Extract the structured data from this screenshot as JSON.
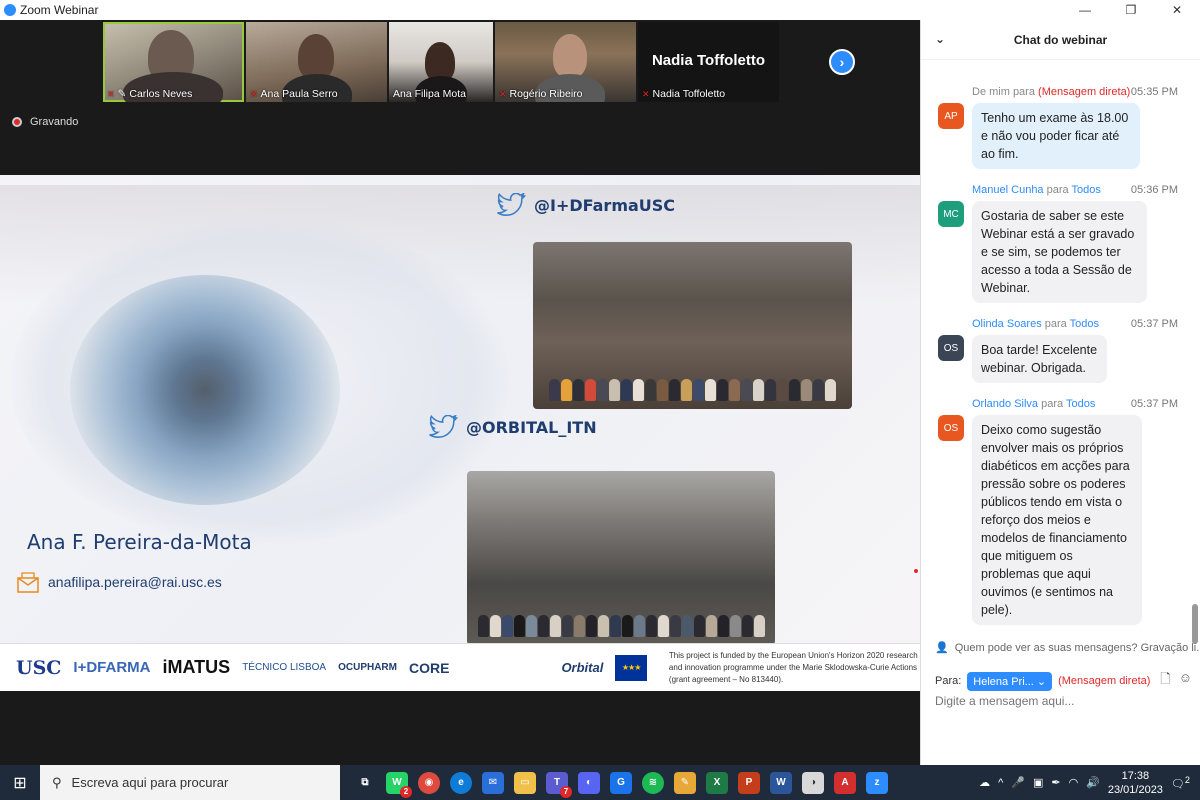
{
  "window": {
    "title": "Zoom Webinar"
  },
  "gallery": {
    "participants": [
      {
        "name": "Carlos Neves"
      },
      {
        "name": "Ana Paula Serro"
      },
      {
        "name": "Ana Filipa Mota"
      },
      {
        "name": "Rogério Ribeiro"
      },
      {
        "name": "Nadia Toffoletto"
      }
    ],
    "big_name": "Nadia Toffoletto"
  },
  "recording": {
    "label": "Gravando"
  },
  "slide": {
    "handle1": "@I+DFarmaUSC",
    "handle2": "@ORBITAL_ITN",
    "presenter": "Ana F. Pereira-da-Mota",
    "email": "anafilipa.pereira@rai.usc.es",
    "logos": {
      "usc": "USC",
      "farma": "I+DFARMA",
      "imatus": "iMATUS",
      "tecnico": "TÉCNICO LISBOA",
      "ocupharm": "OCUPHARM",
      "core": "CORE",
      "orbital": "Orbital"
    },
    "funding": "This project is funded by the European Union's Horizon 2020 research and innovation programme under the Marie Sklodowska-Curie Actions (grant agreement – No 813440)."
  },
  "chat": {
    "title": "Chat do webinar",
    "messages": [
      {
        "initials": "AP",
        "avatar_color": "#e8571f",
        "from": "De mim para",
        "to": "(Mensagem direta)",
        "time": "05:35 PM",
        "text": "Tenho um exame às 18.00 e não vou poder ficar até ao fim.",
        "mine": true
      },
      {
        "initials": "MC",
        "avatar_color": "#1f9e7e",
        "from": "Manuel Cunha",
        "connector": " para ",
        "to": "Todos",
        "time": "05:36 PM",
        "text": "Gostaria de saber se este Webinar está a ser gravado e se sim, se podemos ter acesso a toda a Sessão de Webinar."
      },
      {
        "initials": "OS",
        "avatar_color": "#3a4656",
        "from": "Olinda Soares",
        "connector": " para ",
        "to": "Todos",
        "time": "05:37 PM",
        "text": "Boa tarde! Excelente webinar. Obrigada."
      },
      {
        "initials": "OS",
        "avatar_color": "#e8571f",
        "from": "Orlando Silva",
        "connector": " para ",
        "to": "Todos",
        "time": "05:37 PM",
        "text": "Deixo como sugestão envolver mais os próprios diabéticos em acções para pressão sobre os poderes públicos tendo em vista o reforço dos meios e modelos de financiamento que mitiguem os problemas que aqui ouvimos (e sentimos na pele)."
      }
    ],
    "notice": "Quem pode ver as suas mensagens? Gravação li...",
    "to_label": "Para:",
    "to_value": "Helena Pri...",
    "to_dm": "(Mensagem direta)",
    "input_placeholder": "Digite a mensagem aqui..."
  },
  "taskbar": {
    "search_placeholder": "Escreva aqui para procurar",
    "time": "17:38",
    "date": "23/01/2023",
    "whatsapp_badge": "2",
    "teams_badge": "7",
    "notifications_badge": "2"
  }
}
